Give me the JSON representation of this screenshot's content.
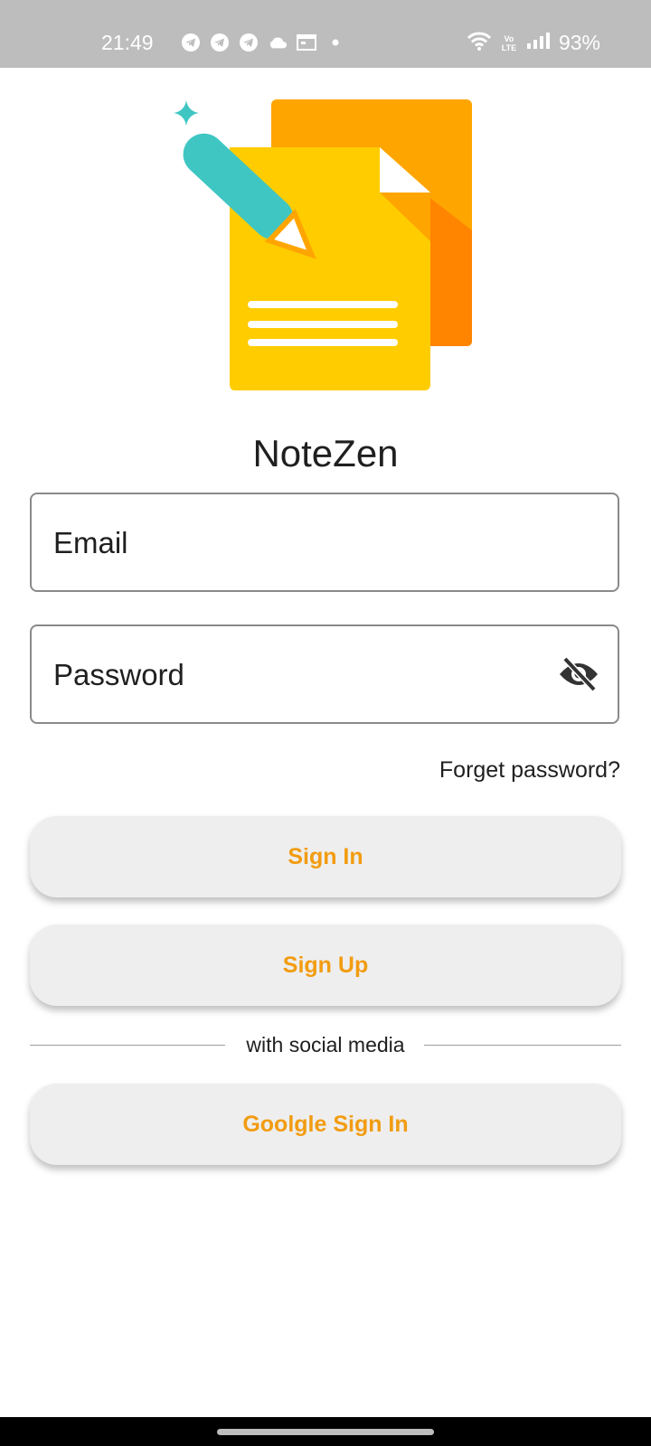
{
  "status_bar": {
    "time": "21:49",
    "battery": "93%",
    "volte_line1": "Vo",
    "volte_line2": "LTE",
    "left_icons": [
      "telegram-icon",
      "telegram-icon",
      "telegram-icon",
      "cloud-icon",
      "calendar-icon",
      "dot-icon"
    ],
    "right_icons": [
      "wifi-icon",
      "volte-icon",
      "signal-icon"
    ]
  },
  "app": {
    "title": "NoteZen"
  },
  "login_form": {
    "email_placeholder": "Email",
    "password_placeholder": "Password",
    "visibility_icon": "eye-off-icon",
    "forgot_password": "Forget password?"
  },
  "buttons": {
    "sign_in": "Sign In",
    "sign_up": "Sign Up",
    "google_sign_in": "Goolgle Sign In"
  },
  "divider": {
    "text": "with social media"
  },
  "colors": {
    "accent": "#f29c11",
    "button_bg": "#eeeeee",
    "status_bar": "#bdbdbd",
    "doc_front": "#ffcc00",
    "doc_back": "#ffa500",
    "pencil": "#3fc6c3"
  }
}
